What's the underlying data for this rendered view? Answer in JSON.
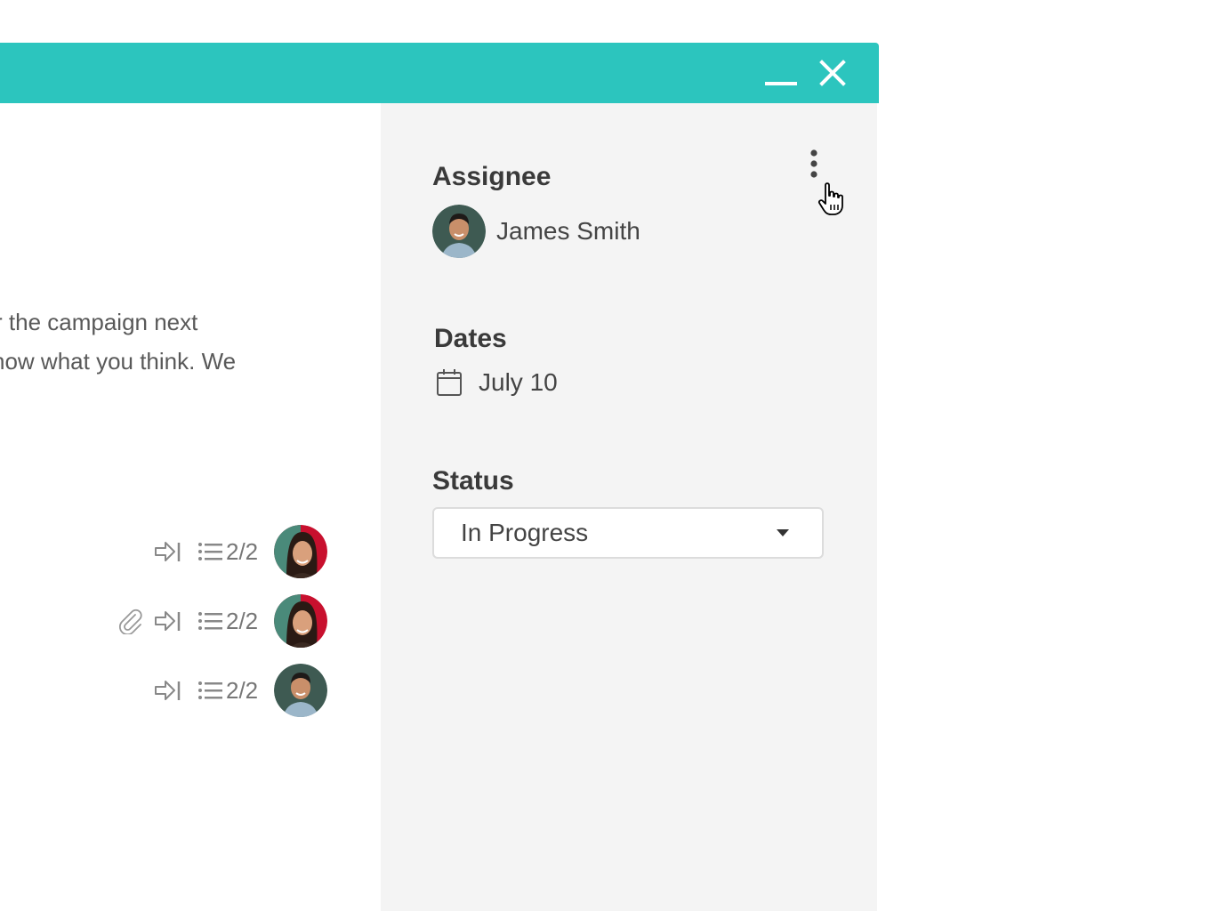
{
  "colors": {
    "titlebar": "#2cc5be",
    "panel_bg": "#f4f4f4",
    "text": "#444444"
  },
  "window": {
    "minimize_icon": "minimize-icon",
    "close_icon": "close-icon"
  },
  "description": {
    "lines": [
      "r the campaign next",
      "know what you think. We"
    ]
  },
  "tasks": [
    {
      "attachment": false,
      "checklist": "2/2",
      "avatar": "woman-avatar"
    },
    {
      "attachment": true,
      "checklist": "2/2",
      "avatar": "woman-avatar"
    },
    {
      "attachment": false,
      "checklist": "2/2",
      "avatar": "man-avatar"
    }
  ],
  "side_panel": {
    "assignee_label": "Assignee",
    "assignee_name": "James Smith",
    "dates_label": "Dates",
    "date_value": "July 10",
    "status_label": "Status",
    "status_value": "In Progress"
  }
}
